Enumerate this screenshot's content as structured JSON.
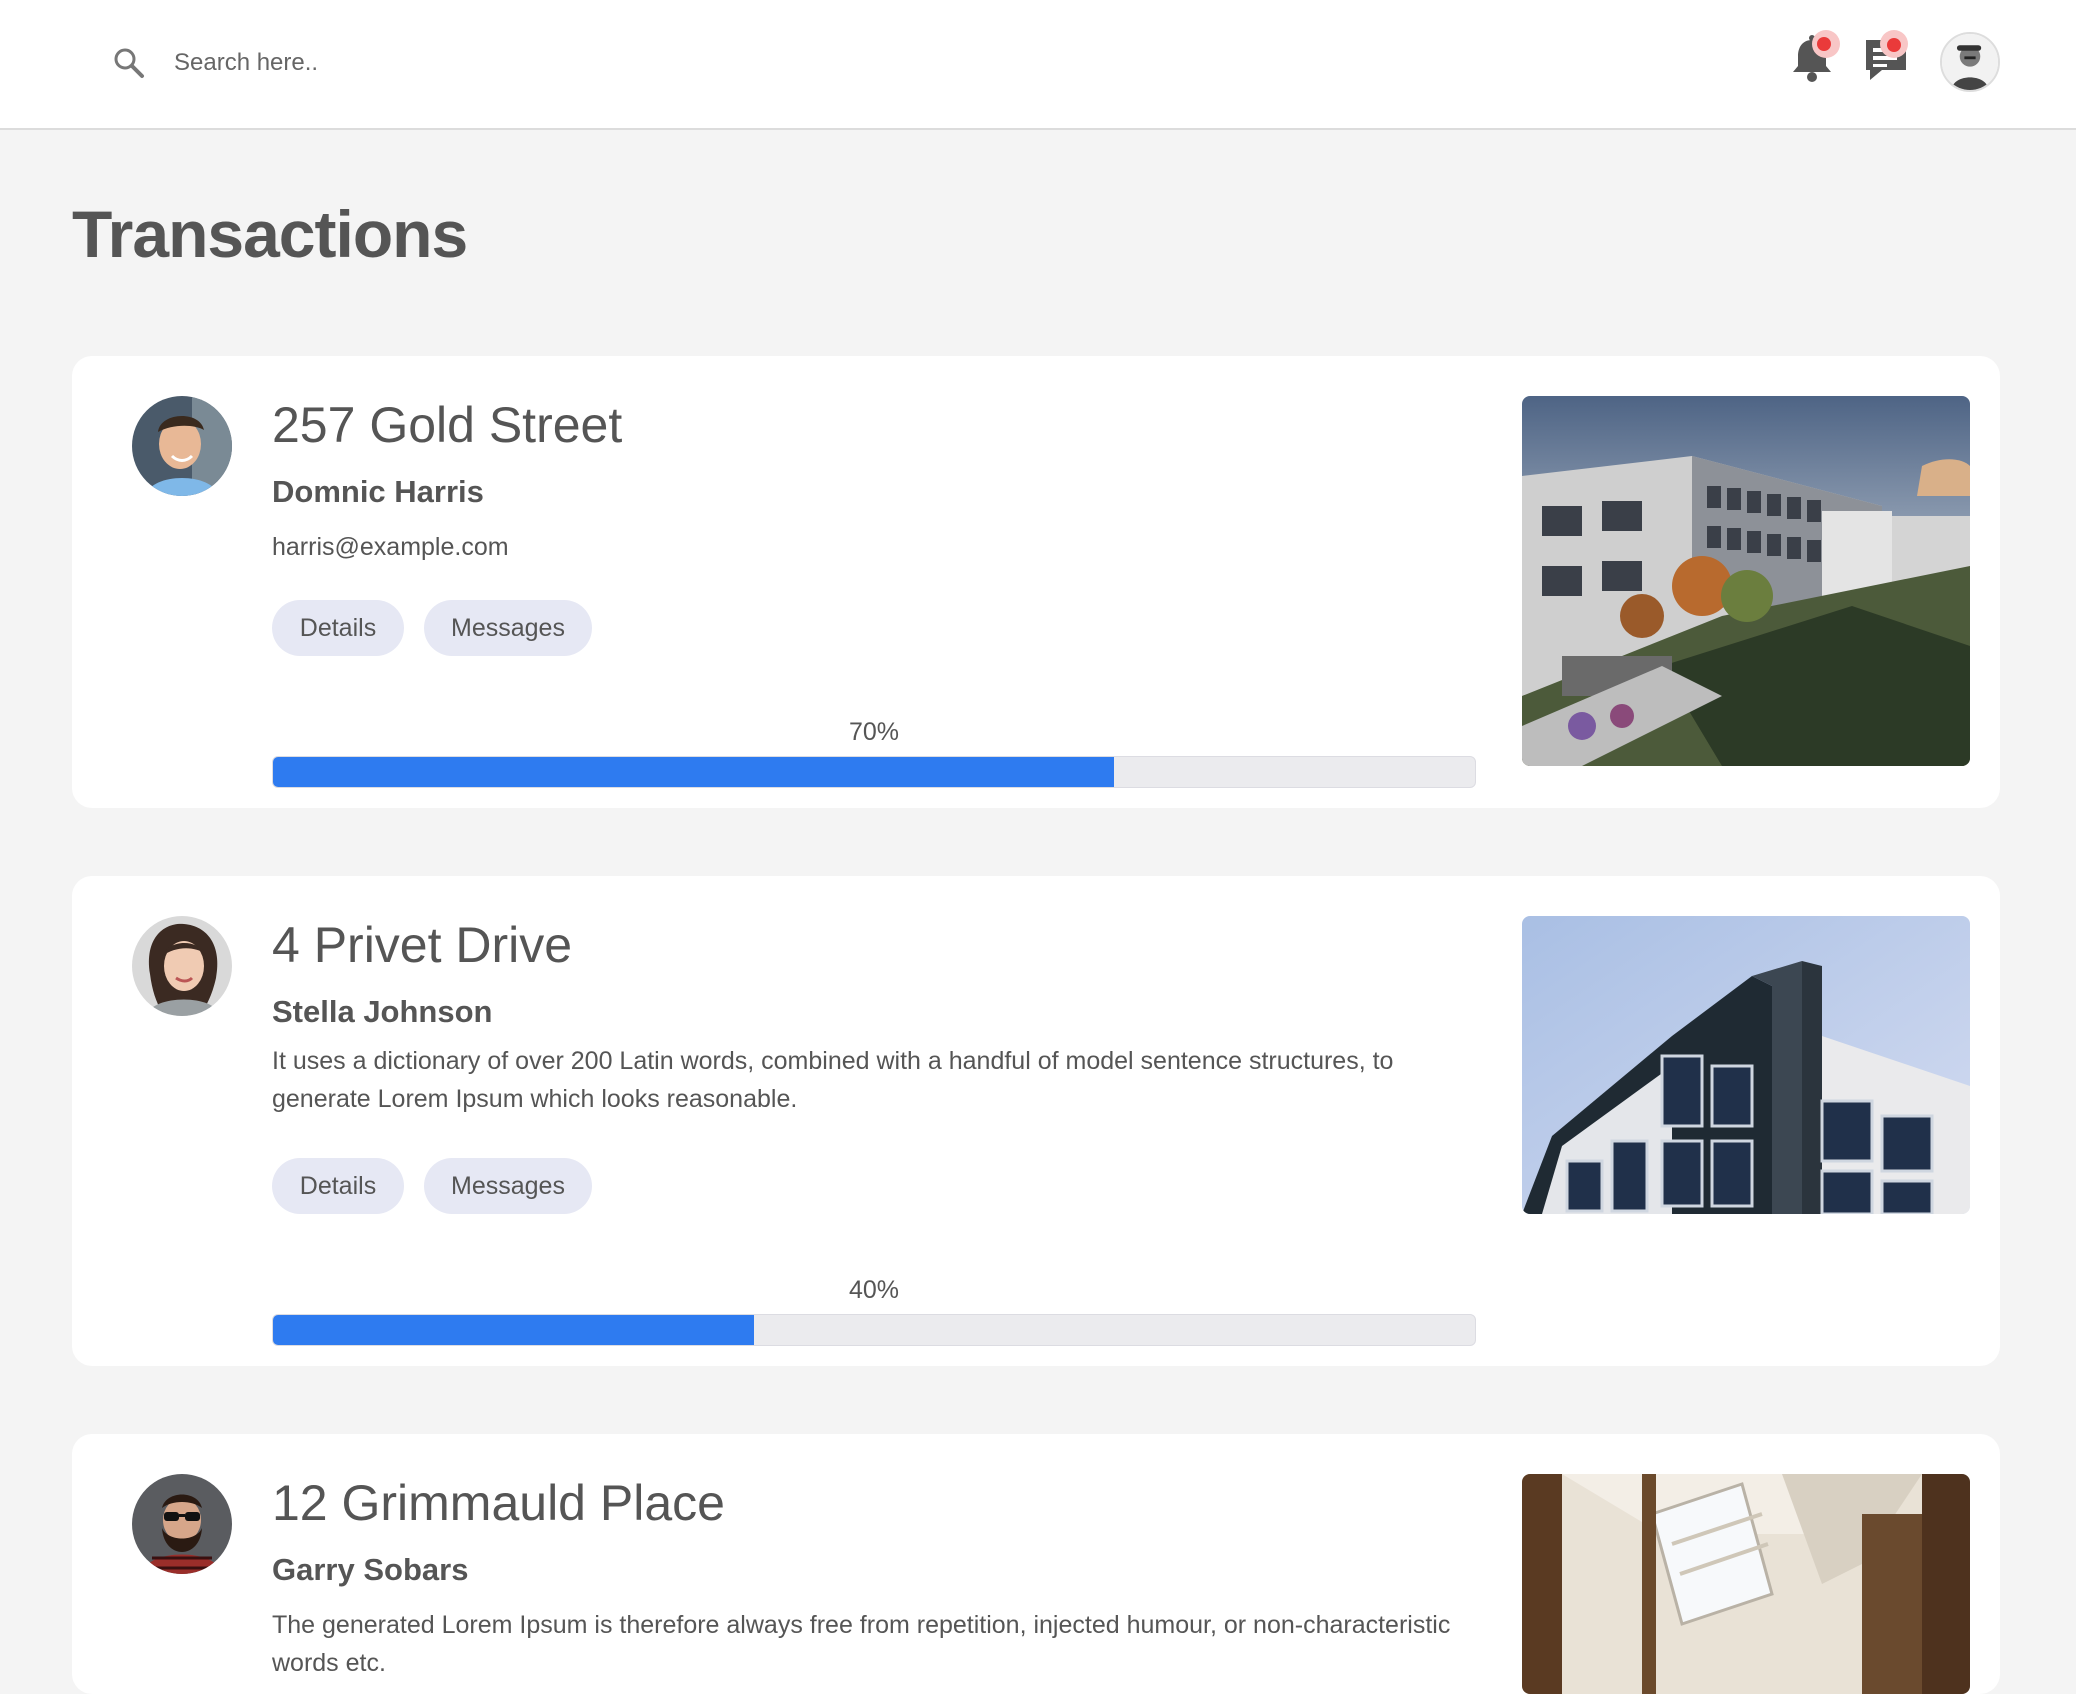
{
  "search": {
    "placeholder": "Search here.."
  },
  "header": {
    "icons": [
      "search-icon",
      "bell-icon",
      "chat-icon",
      "user-avatar"
    ],
    "badge_color": "#ea3a3a"
  },
  "page": {
    "title": "Transactions"
  },
  "accent_color": "#2e7bf0",
  "transactions": [
    {
      "address": "257 Gold Street",
      "name": "Domnic Harris",
      "detail": "harris@example.com",
      "details_label": "Details",
      "messages_label": "Messages",
      "progress": 70,
      "progress_label": "70%"
    },
    {
      "address": "4 Privet Drive",
      "name": "Stella Johnson",
      "detail": "It uses a dictionary of over 200 Latin words, combined with a handful of model sentence structures, to generate Lorem Ipsum which looks reasonable.",
      "details_label": "Details",
      "messages_label": "Messages",
      "progress": 40,
      "progress_label": "40%"
    },
    {
      "address": "12 Grimmauld Place",
      "name": "Garry Sobars",
      "detail": "The generated Lorem Ipsum is therefore always free from repetition, injected humour, or non-characteristic words etc."
    }
  ]
}
